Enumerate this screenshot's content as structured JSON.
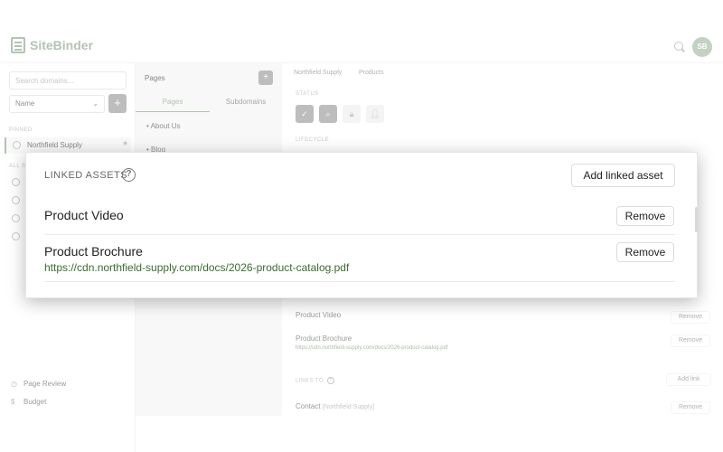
{
  "app": {
    "name": "SiteBinder",
    "user_initials": "SB"
  },
  "sidebar": {
    "search_placeholder": "Search domains...",
    "sort_value": "Name",
    "pinned_label": "PINNED",
    "pinned_item": "Northfield Supply",
    "all_label": "ALL S",
    "footer": [
      {
        "label": "Page Review",
        "icon": "clock-icon"
      },
      {
        "label": "Budget",
        "icon": "dollar-icon"
      }
    ]
  },
  "pages_panel": {
    "title": "Pages",
    "tabs": [
      "Pages",
      "Subdomains"
    ],
    "items": [
      "About Us",
      "Blog"
    ]
  },
  "content": {
    "breadcrumb": [
      "Northfield Supply",
      "Products"
    ],
    "status_label": "STATUS",
    "lifecycle_label": "LIFECYCLE",
    "links_to_label": "LINKS TO",
    "add_link": "Add link",
    "assets": [
      {
        "title": "Product Video",
        "remove": "Remove"
      },
      {
        "title": "Product Brochure",
        "url": "https://cdn.northfield-supply.com/docs/2026-product-catalog.pdf",
        "remove": "Remove"
      }
    ],
    "links": [
      {
        "title": "Contact",
        "note": "[Northfield Supply]",
        "remove": "Remove"
      }
    ]
  },
  "modal": {
    "heading": "LINKED ASSETS",
    "add_button": "Add linked asset",
    "assets": [
      {
        "title": "Product Video",
        "remove": "Remove"
      },
      {
        "title": "Product Brochure",
        "url": "https://cdn.northfield-supply.com/docs/2026-product-catalog.pdf",
        "remove": "Remove"
      }
    ]
  },
  "colors": {
    "brand": "#8ba38a",
    "url_green": "#3a6b2f"
  }
}
